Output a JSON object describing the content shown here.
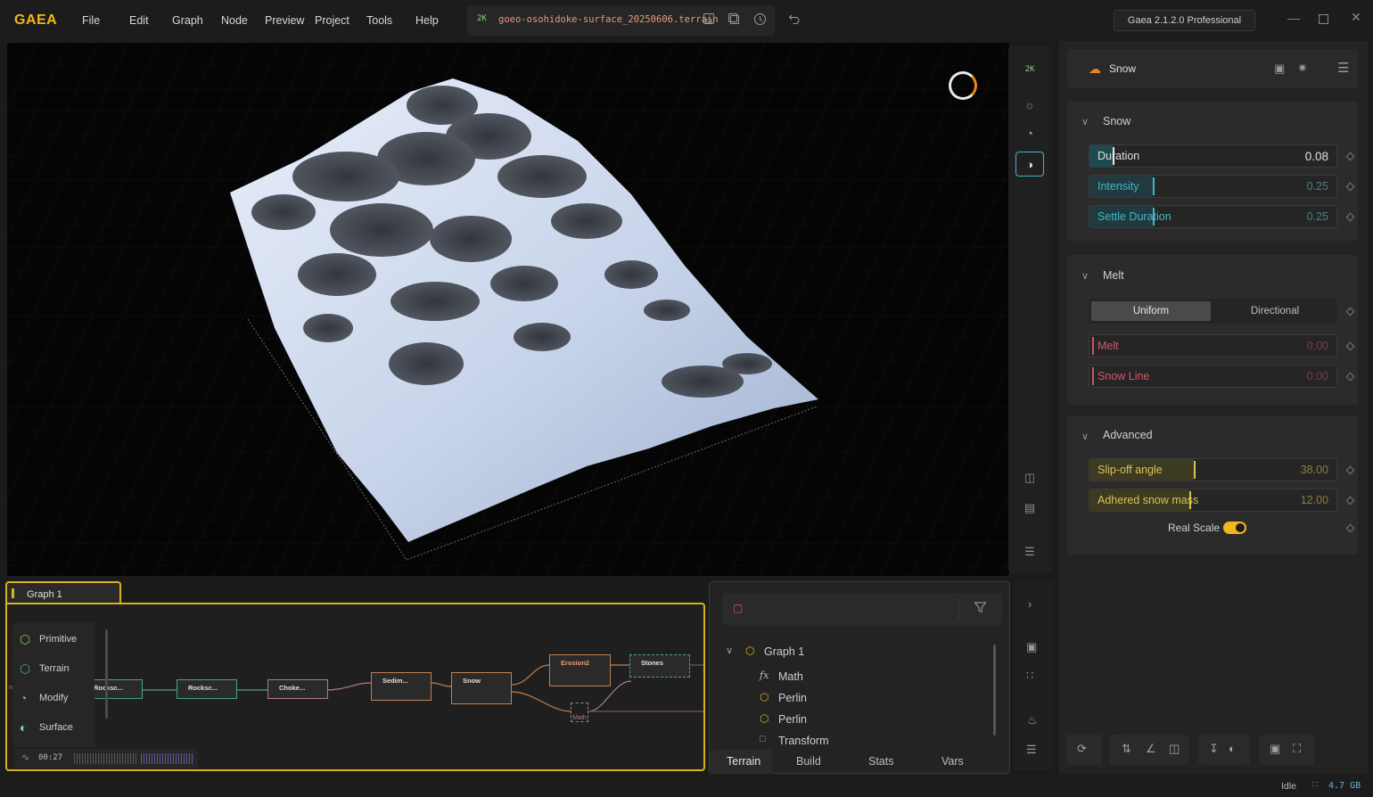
{
  "app": {
    "logo": "GAEA",
    "menu": [
      "File",
      "Edit",
      "Graph",
      "Node",
      "Preview",
      "Project",
      "Tools",
      "Help"
    ],
    "file": {
      "resolution": "2K",
      "name": "goeo-osohidoke-surface_20250606.terrain"
    },
    "version": "Gaea 2.1.2.0 Professional"
  },
  "viewport_tools": {
    "resolution": "2K"
  },
  "node_panel": {
    "node_name": "Snow",
    "sections": {
      "snow": {
        "title": "Snow",
        "params": [
          {
            "label": "Duration",
            "value": "0.08",
            "fraction": 0.08
          },
          {
            "label": "Intensity",
            "value": "0.25",
            "fraction": 0.25
          },
          {
            "label": "Settle Duration",
            "value": "0.25",
            "fraction": 0.25
          }
        ]
      },
      "melt": {
        "title": "Melt",
        "mode_options": [
          "Uniform",
          "Directional"
        ],
        "selected_mode": "Uniform",
        "params": [
          {
            "label": "Melt",
            "value": "0.00",
            "fraction": 0
          },
          {
            "label": "Snow Line",
            "value": "0.00",
            "fraction": 0
          }
        ]
      },
      "advanced": {
        "title": "Advanced",
        "params": [
          {
            "label": "Slip-off angle",
            "value": "38.00",
            "fraction": 0.42
          },
          {
            "label": "Adhered snow mass",
            "value": "12.00",
            "fraction": 0.4
          }
        ],
        "real_scale_label": "Real Scale",
        "real_scale_on": true
      }
    }
  },
  "graph": {
    "tab_label": "Graph 1",
    "palette": [
      "Primitive",
      "Terrain",
      "Modify",
      "Surface"
    ],
    "nodes": [
      "Rocksc...",
      "Rocksc...",
      "Choke...",
      "Sedim...",
      "Snow",
      "Erosion2",
      "Stones",
      "Math"
    ],
    "timer": "00:27"
  },
  "tree": {
    "root": "Graph 1",
    "items": [
      "Math",
      "Perlin",
      "Perlin",
      "Transform"
    ],
    "tabs": [
      "Terrain",
      "Build",
      "Stats",
      "Vars"
    ],
    "active_tab": "Terrain"
  },
  "status": {
    "state": "Idle",
    "memory": "4.7 GB"
  },
  "colors": {
    "accent": "#f0b81c",
    "snow_param": "#3fb6c8",
    "melt_param": "#d0566a",
    "advanced_param": "#d7c25a"
  }
}
